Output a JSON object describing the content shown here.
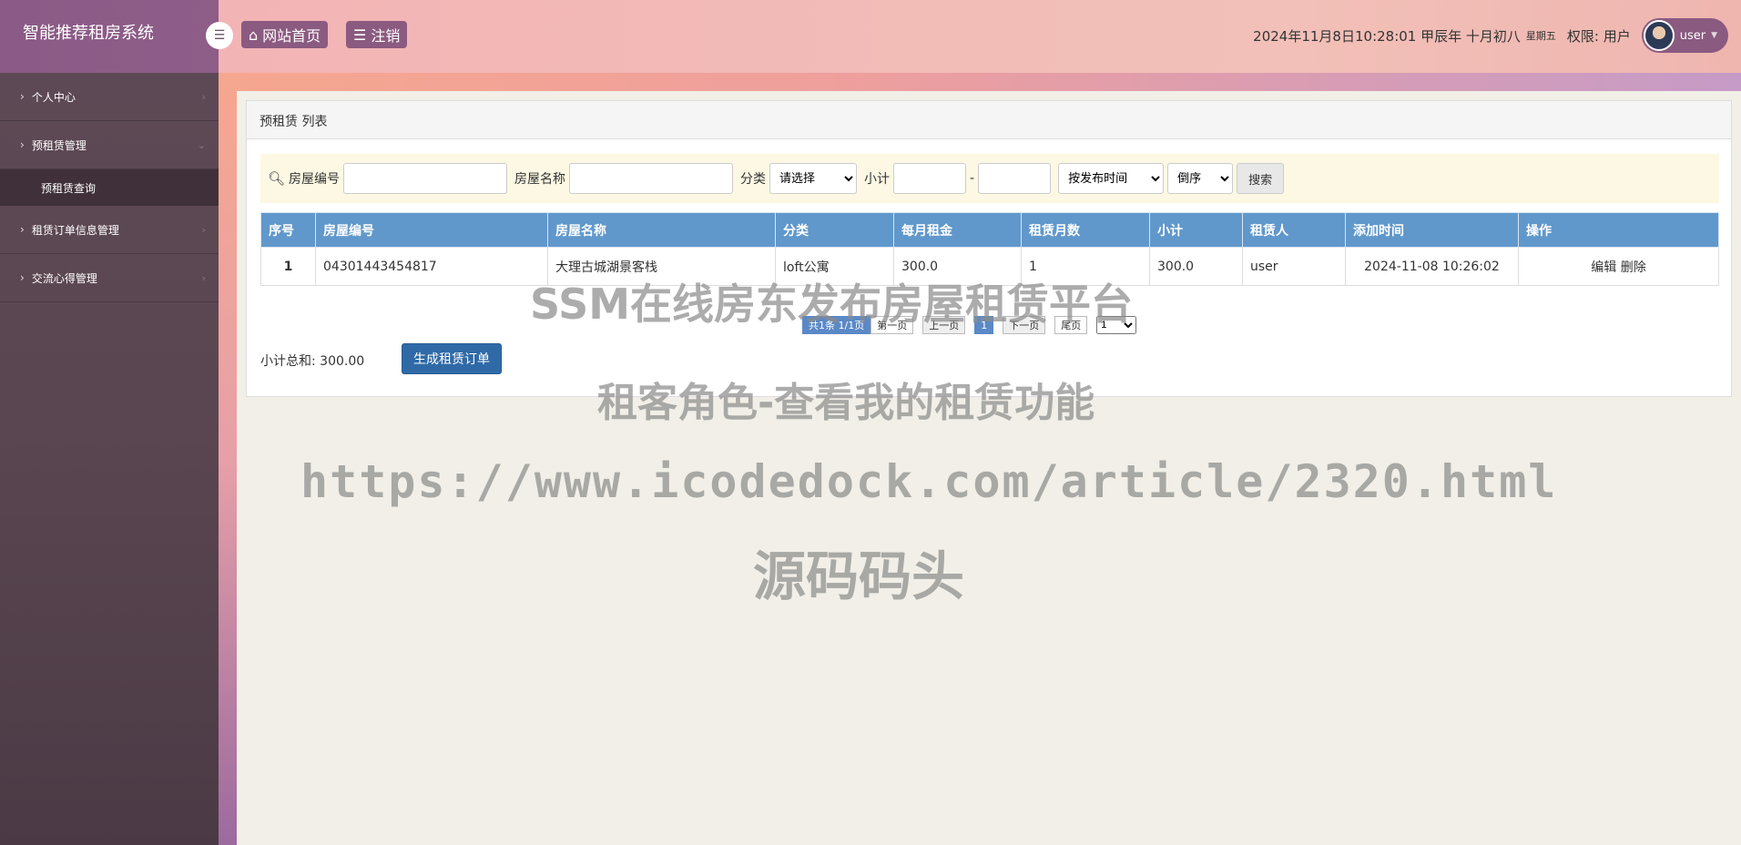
{
  "app": {
    "title": "智能推荐租房系统"
  },
  "sidebar": {
    "items": [
      {
        "label": "个人中心"
      },
      {
        "label": "预租赁管理",
        "sub": [
          {
            "label": "预租赁查询"
          }
        ]
      },
      {
        "label": "租赁订单信息管理"
      },
      {
        "label": "交流心得管理"
      }
    ]
  },
  "header": {
    "home_label": "网站首页",
    "logout_label": "注销",
    "datetime": "2024年11月8日10:28:01 甲辰年 十月初八",
    "weekday": "星期五",
    "permission": "权限: 用户",
    "username": "user"
  },
  "panel": {
    "title": "预租赁 列表",
    "search": {
      "house_no_label": "房屋编号",
      "house_name_label": "房屋名称",
      "category_label": "分类",
      "category_value": "请选择",
      "subtotal_label": "小计",
      "range_sep": "-",
      "sort_by": "按发布时间",
      "order": "倒序",
      "search_button": "搜索"
    },
    "table": {
      "headers": [
        "序号",
        "房屋编号",
        "房屋名称",
        "分类",
        "每月租金",
        "租赁月数",
        "小计",
        "租赁人",
        "添加时间",
        "操作"
      ],
      "rows": [
        {
          "index": "1",
          "house_no": "04301443454817",
          "house_name": "大理古城湖景客栈",
          "category": "loft公寓",
          "rent": "300.0",
          "months": "1",
          "subtotal": "300.0",
          "tenant": "user",
          "added": "2024-11-08 10:26:02",
          "edit": "编辑",
          "delete": "删除"
        }
      ]
    },
    "pager": {
      "info": "共1条  1/1页",
      "first": "第一页",
      "prev": "上一页",
      "current": "1",
      "next": "下一页",
      "last": "尾页",
      "select": "1"
    },
    "total": "小计总和: 300.00",
    "generate_button": "生成租赁订单"
  },
  "watermarks": {
    "line1": "SSM在线房东发布房屋租赁平台",
    "line2": "租客角色-查看我的租赁功能",
    "line3": "https://www.icodedock.com/article/2320.html",
    "line4": "源码码头"
  }
}
